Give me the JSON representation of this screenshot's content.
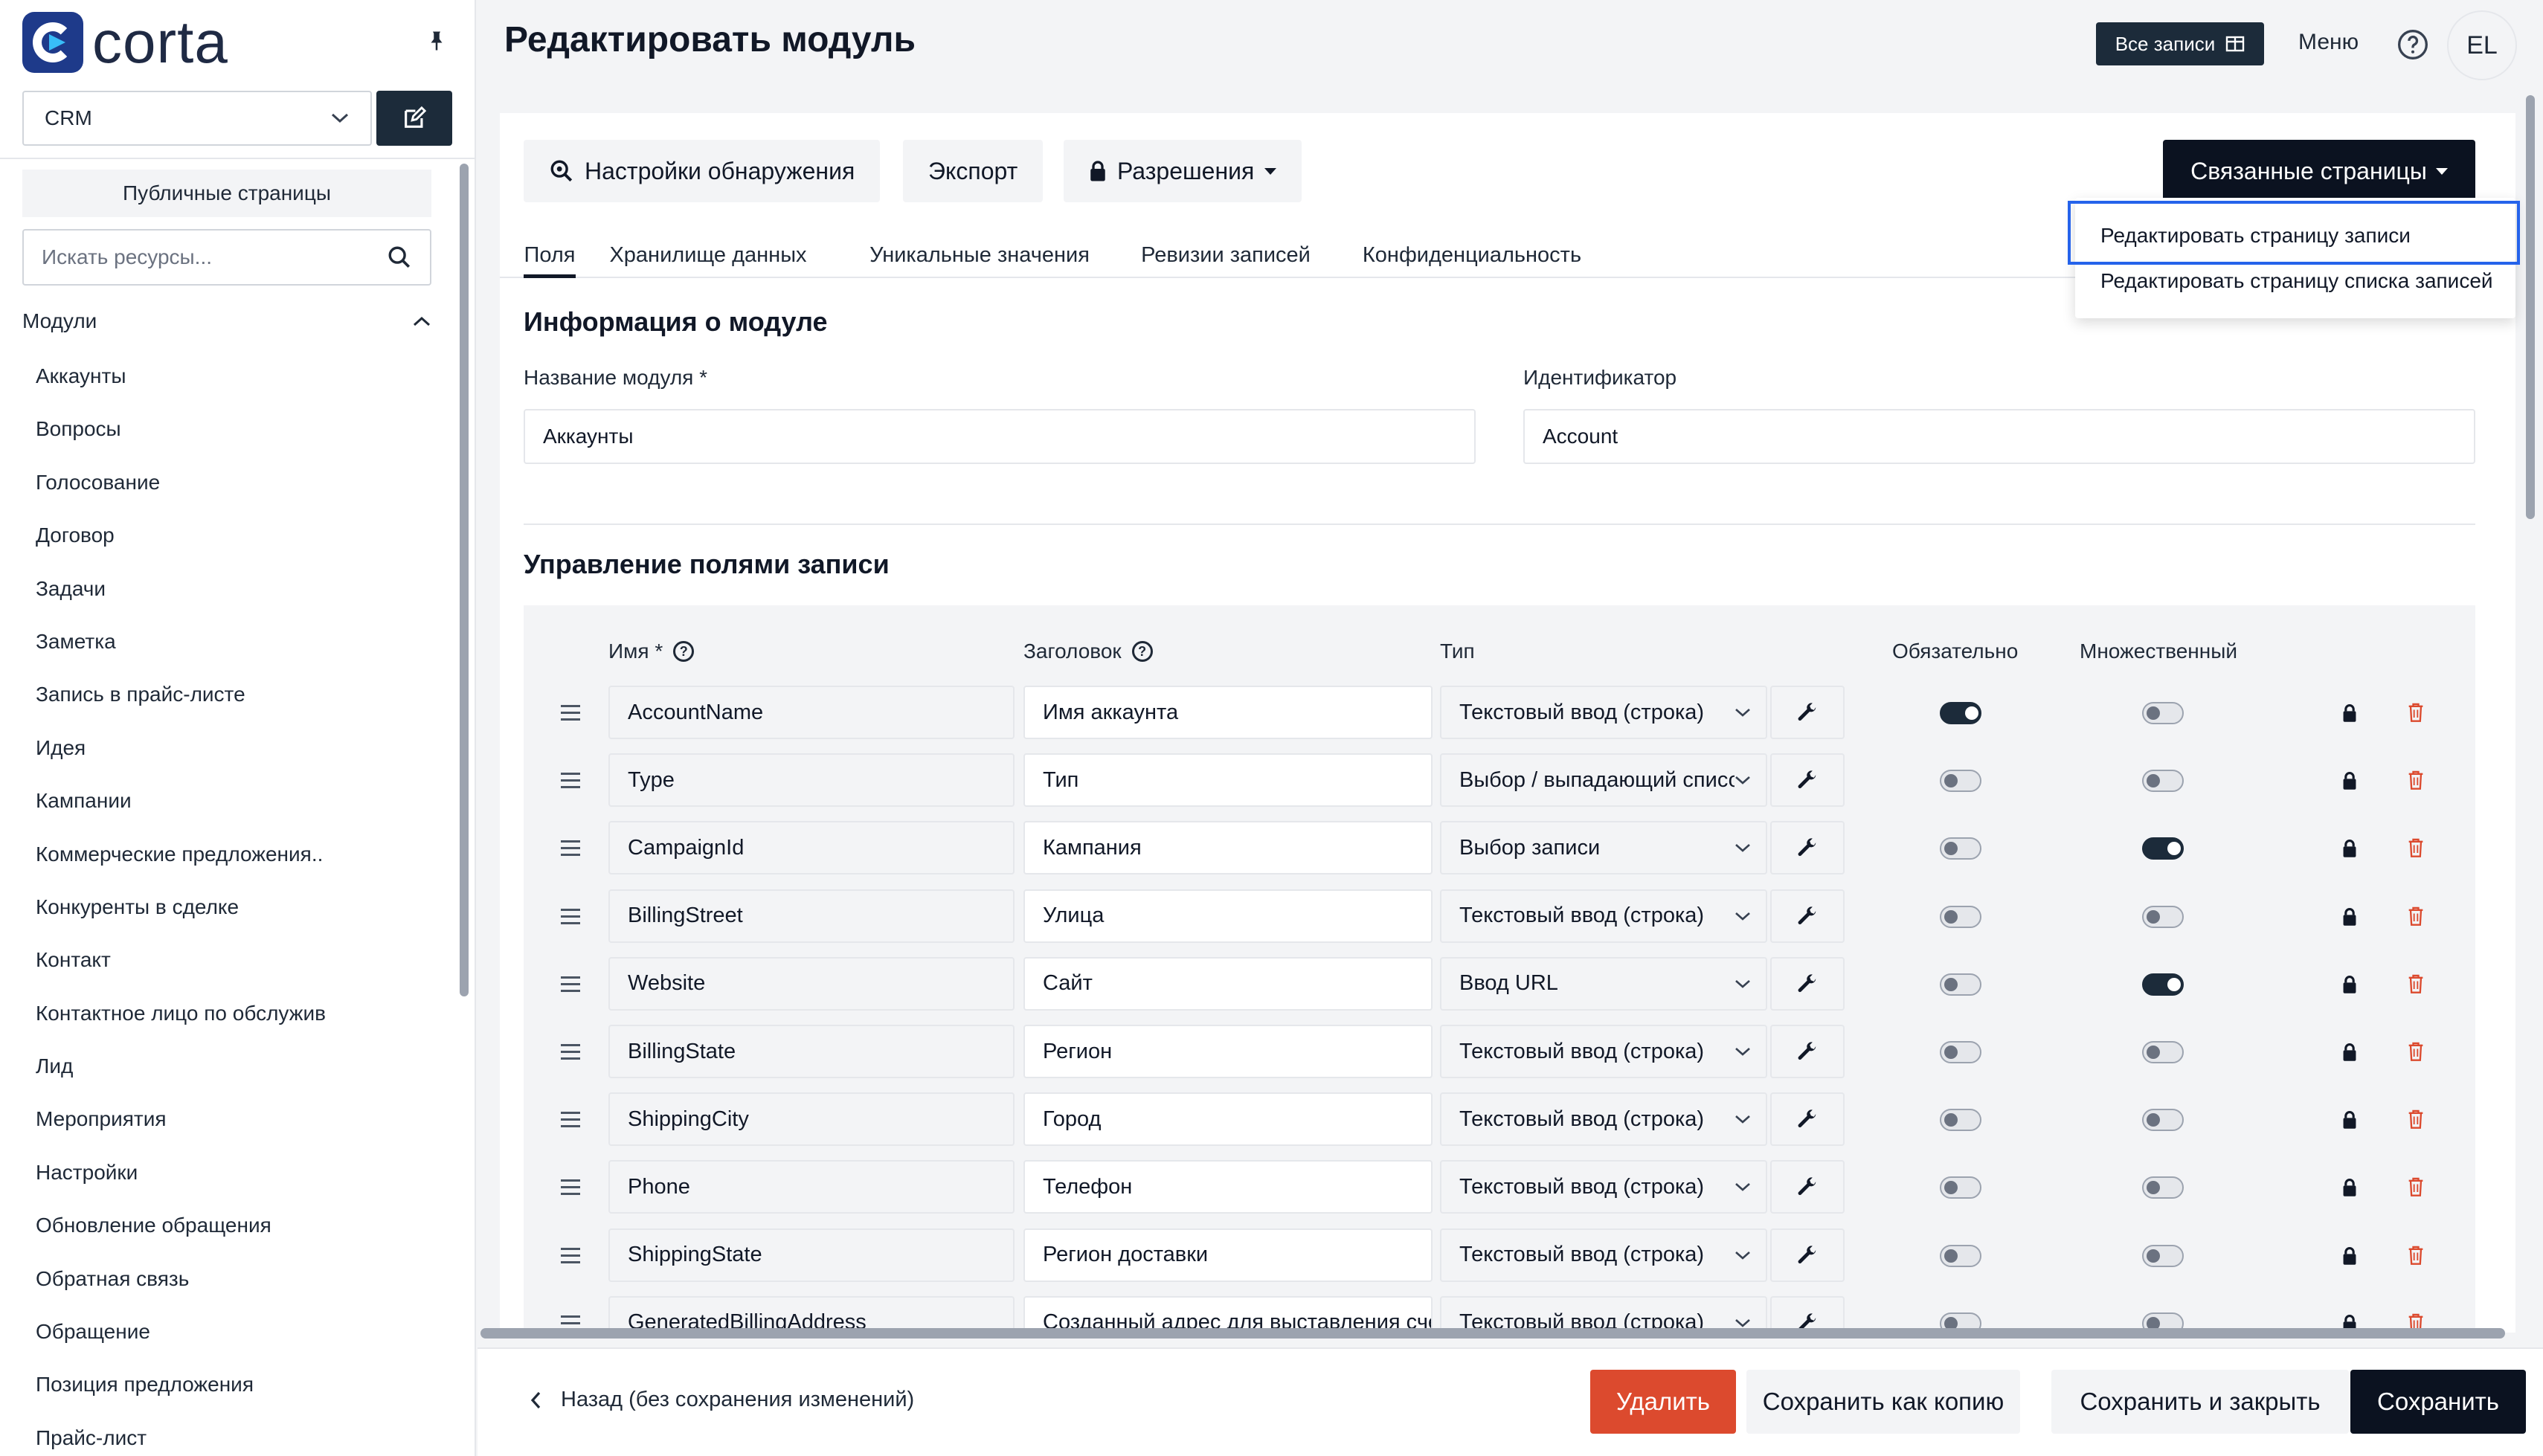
{
  "brand": {
    "name": "corta"
  },
  "sidebar": {
    "app_select": "CRM",
    "public_pages": "Публичные страницы",
    "search_placeholder": "Искать ресурсы...",
    "modules_label": "Модули",
    "modules": [
      "Аккаунты",
      "Вопросы",
      "Голосование",
      "Договор",
      "Задачи",
      "Заметка",
      "Запись в прайс-листе",
      "Идея",
      "Кампании",
      "Коммерческие предложения..",
      "Конкуренты в сделке",
      "Контакт",
      "Контактное лицо по обслужив",
      "Лид",
      "Мероприятия",
      "Настройки",
      "Обновление обращения",
      "Обратная связь",
      "Обращение",
      "Позиция предложения",
      "Прайс-лист"
    ]
  },
  "header": {
    "title": "Редактировать модуль",
    "all_records": "Все записи",
    "menu": "Меню",
    "avatar": "EL"
  },
  "toolbar": {
    "discovery": "Настройки обнаружения",
    "export": "Экспорт",
    "permissions": "Разрешения",
    "related_pages": "Связанные страницы"
  },
  "dropdown": {
    "items": [
      "Редактировать страницу записи",
      "Редактировать страницу списка записей"
    ]
  },
  "tabs": [
    "Поля",
    "Хранилище данных",
    "Уникальные значения",
    "Ревизии записей",
    "Конфиденциальность"
  ],
  "module_info": {
    "title": "Информация о модуле",
    "name_label": "Название модуля *",
    "name_value": "Аккаунты",
    "id_label": "Идентификатор",
    "id_value": "Account"
  },
  "fields_section": {
    "title": "Управление полями записи",
    "columns": {
      "name": "Имя *",
      "title": "Заголовок",
      "type": "Тип",
      "required": "Обязательно",
      "multiple": "Множественный"
    },
    "rows": [
      {
        "name": "AccountName",
        "title": "Имя аккаунта",
        "type": "Текстовый ввод (строка)",
        "required": true,
        "multiple": false
      },
      {
        "name": "Type",
        "title": "Тип",
        "type": "Выбор / выпадающий список",
        "required": false,
        "multiple": false
      },
      {
        "name": "CampaignId",
        "title": "Кампания",
        "type": "Выбор записи",
        "required": false,
        "multiple": true
      },
      {
        "name": "BillingStreet",
        "title": "Улица",
        "type": "Текстовый ввод (строка)",
        "required": false,
        "multiple": false
      },
      {
        "name": "Website",
        "title": "Сайт",
        "type": "Ввод URL",
        "required": false,
        "multiple": true
      },
      {
        "name": "BillingState",
        "title": "Регион",
        "type": "Текстовый ввод (строка)",
        "required": false,
        "multiple": false
      },
      {
        "name": "ShippingCity",
        "title": "Город",
        "type": "Текстовый ввод (строка)",
        "required": false,
        "multiple": false
      },
      {
        "name": "Phone",
        "title": "Телефон",
        "type": "Текстовый ввод (строка)",
        "required": false,
        "multiple": false
      },
      {
        "name": "ShippingState",
        "title": "Регион доставки",
        "type": "Текстовый ввод (строка)",
        "required": false,
        "multiple": false
      },
      {
        "name": "GeneratedBillingAddress",
        "title": "Созданный адрес для выставления счета",
        "type": "Текстовый ввод (строка)",
        "required": false,
        "multiple": false
      }
    ]
  },
  "footer": {
    "back": "Назад (без сохранения изменений)",
    "delete": "Удалить",
    "save_copy": "Сохранить как копию",
    "save_close": "Сохранить и закрыть",
    "save": "Сохранить"
  },
  "colors": {
    "primary_dark": "#0b1220",
    "danger": "#dc4a2e",
    "focus": "#2563eb"
  }
}
